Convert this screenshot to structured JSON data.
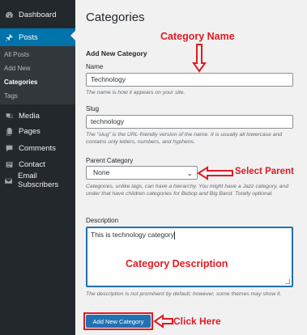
{
  "sidebar": {
    "dashboard": "Dashboard",
    "posts": "Posts",
    "sub": [
      "All Posts",
      "Add New",
      "Categories",
      "Tags"
    ],
    "media": "Media",
    "pages": "Pages",
    "comments": "Comments",
    "contact": "Contact",
    "email_subscribers": "Email Subscribers"
  },
  "page": {
    "title": "Categories",
    "section_title": "Add New Category"
  },
  "form": {
    "name_label": "Name",
    "name_value": "Technology",
    "name_desc": "The name is how it appears on your site.",
    "slug_label": "Slug",
    "slug_value": "technology",
    "slug_desc": "The \"slug\" is the URL-friendly version of the name. It is usually all lowercase and contains only letters, numbers, and hyphens.",
    "parent_label": "Parent Category",
    "parent_value": "None",
    "parent_desc": "Categories, unlike tags, can have a hierarchy. You might have a Jazz category, and under that have children categories for Bebop and Big Band. Totally optional.",
    "description_label": "Description",
    "description_value": "This is technology category",
    "description_desc": "The description is not prominent by default; however, some themes may show it.",
    "submit_label": "Add New Category"
  },
  "annotations": {
    "category_name": "Category Name",
    "select_parent": "Select Parent",
    "category_description": "Category Description",
    "click_here": "Click Here",
    "color": "#e01b24"
  },
  "colors": {
    "sidebar_bg": "#23282d",
    "active_bg": "#0073aa",
    "button_bg": "#2271b1"
  }
}
